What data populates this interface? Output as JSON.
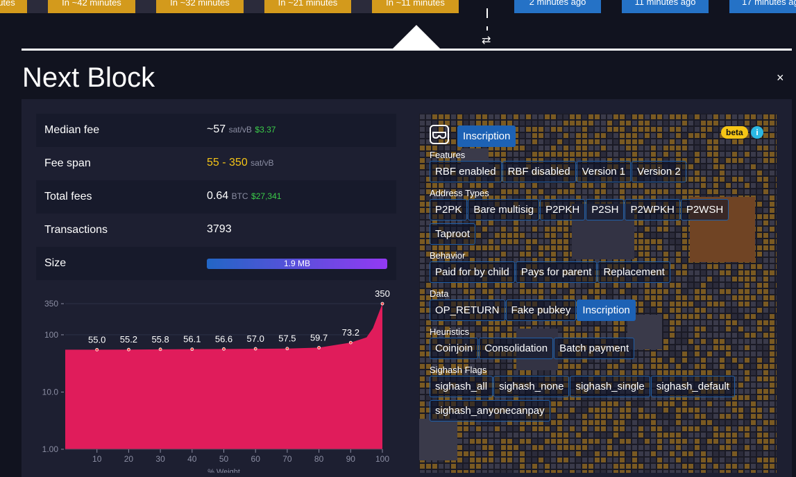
{
  "blocks_pending": [
    {
      "label": "utes"
    },
    {
      "label": "In ~42 minutes"
    },
    {
      "label": "In ~32 minutes"
    },
    {
      "label": "In ~21 minutes"
    },
    {
      "label": "In ~11 minutes"
    }
  ],
  "blocks_mined": [
    {
      "label": "2 minutes ago"
    },
    {
      "label": "11 minutes ago"
    },
    {
      "label": "17 minutes ago"
    }
  ],
  "swap_icon": "⇄",
  "title": "Next Block",
  "close_label": "×",
  "stats": {
    "median_fee": {
      "label": "Median fee",
      "value": "~57",
      "unit": "sat/vB",
      "fiat": "$3.37"
    },
    "fee_span": {
      "label": "Fee span",
      "value": "55 - 350",
      "unit": "sat/vB"
    },
    "total_fees": {
      "label": "Total fees",
      "value": "0.64",
      "unit": "BTC",
      "fiat": "$27,341"
    },
    "transactions": {
      "label": "Transactions",
      "value": "3793"
    },
    "size": {
      "label": "Size",
      "value": "1.9 MB"
    }
  },
  "chart_data": {
    "type": "area",
    "y_scale": "log",
    "ylim": [
      1,
      350
    ],
    "yticks": [
      "350",
      "100",
      "10.0",
      "1.00"
    ],
    "xticks": [
      "10",
      "20",
      "30",
      "40",
      "50",
      "60",
      "70",
      "80",
      "90",
      "100"
    ],
    "xlabel": "% Weight",
    "points": [
      {
        "x": 0,
        "y": 55.0
      },
      {
        "x": 10,
        "y": 55.0
      },
      {
        "x": 20,
        "y": 55.2
      },
      {
        "x": 30,
        "y": 55.8
      },
      {
        "x": 40,
        "y": 56.1
      },
      {
        "x": 50,
        "y": 56.6
      },
      {
        "x": 60,
        "y": 57.0
      },
      {
        "x": 70,
        "y": 57.5
      },
      {
        "x": 80,
        "y": 59.7
      },
      {
        "x": 90,
        "y": 73.2
      },
      {
        "x": 95,
        "y": 90
      },
      {
        "x": 97,
        "y": 130
      },
      {
        "x": 100,
        "y": 350
      }
    ],
    "labels": [
      {
        "x": 10,
        "y": 55.0,
        "text": "55.0"
      },
      {
        "x": 20,
        "y": 55.2,
        "text": "55.2"
      },
      {
        "x": 30,
        "y": 55.8,
        "text": "55.8"
      },
      {
        "x": 40,
        "y": 56.1,
        "text": "56.1"
      },
      {
        "x": 50,
        "y": 56.6,
        "text": "56.6"
      },
      {
        "x": 60,
        "y": 57.0,
        "text": "57.0"
      },
      {
        "x": 70,
        "y": 57.5,
        "text": "57.5"
      },
      {
        "x": 80,
        "y": 59.7,
        "text": "59.7"
      },
      {
        "x": 90,
        "y": 73.2,
        "text": "73.2"
      },
      {
        "x": 100,
        "y": 350,
        "text": "350"
      }
    ],
    "color": "#e01c5b"
  },
  "filters": {
    "active_chip": "Inscription",
    "badge": "beta",
    "info_icon": "i",
    "groups": [
      {
        "title": "Features",
        "chips": [
          {
            "label": "RBF enabled"
          },
          {
            "label": "RBF disabled"
          },
          {
            "label": "Version 1"
          },
          {
            "label": "Version 2"
          }
        ]
      },
      {
        "title": "Address Types",
        "chips": [
          {
            "label": "P2PK"
          },
          {
            "label": "Bare multisig"
          },
          {
            "label": "P2PKH"
          },
          {
            "label": "P2SH"
          },
          {
            "label": "P2WPKH"
          },
          {
            "label": "P2WSH"
          },
          {
            "label": "Taproot"
          }
        ]
      },
      {
        "title": "Behavior",
        "chips": [
          {
            "label": "Paid for by child"
          },
          {
            "label": "Pays for parent"
          },
          {
            "label": "Replacement"
          }
        ]
      },
      {
        "title": "Data",
        "chips": [
          {
            "label": "OP_RETURN"
          },
          {
            "label": "Fake pubkey"
          },
          {
            "label": "Inscription",
            "active": true
          }
        ]
      },
      {
        "title": "Heuristics",
        "chips": [
          {
            "label": "Coinjoin"
          },
          {
            "label": "Consolidation"
          },
          {
            "label": "Batch payment"
          }
        ]
      },
      {
        "title": "Sighash Flags",
        "chips": [
          {
            "label": "sighash_all"
          },
          {
            "label": "sighash_none"
          },
          {
            "label": "sighash_single"
          },
          {
            "label": "sighash_default"
          },
          {
            "label": "sighash_anyonecanpay"
          }
        ]
      }
    ]
  },
  "colors": {
    "accent": "#d39a1c",
    "mined": "#2572c6",
    "chart": "#e01c5b",
    "fiat": "#3bcc49"
  }
}
